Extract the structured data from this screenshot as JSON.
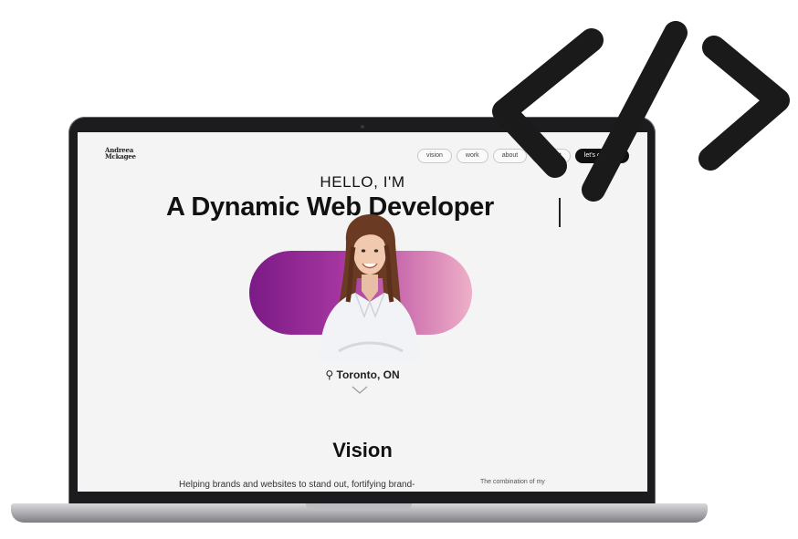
{
  "site": {
    "logo_text": "Andreea Mckagee",
    "nav": {
      "items": [
        "vision",
        "work",
        "about",
        "contact"
      ],
      "cta_label": "let's connect"
    },
    "hero": {
      "greeting": "HELLO, I'M",
      "headline": "A Dynamic Web Developer",
      "location": "Toronto, ON"
    },
    "vision": {
      "title": "Vision",
      "text": "Helping brands and websites to stand out, fortifying brand-",
      "side_text": "The combination of my"
    }
  },
  "icons": {
    "location": "map-pin-icon",
    "scroll": "chevron-down-icon",
    "code": "code-tag-icon"
  },
  "colors": {
    "gradient_start": "#7b1a86",
    "gradient_end": "#eeb0c8",
    "accent_dark": "#111111",
    "laptop_bezel": "#1c1c1e",
    "code_symbol": "#1a1a1a"
  }
}
